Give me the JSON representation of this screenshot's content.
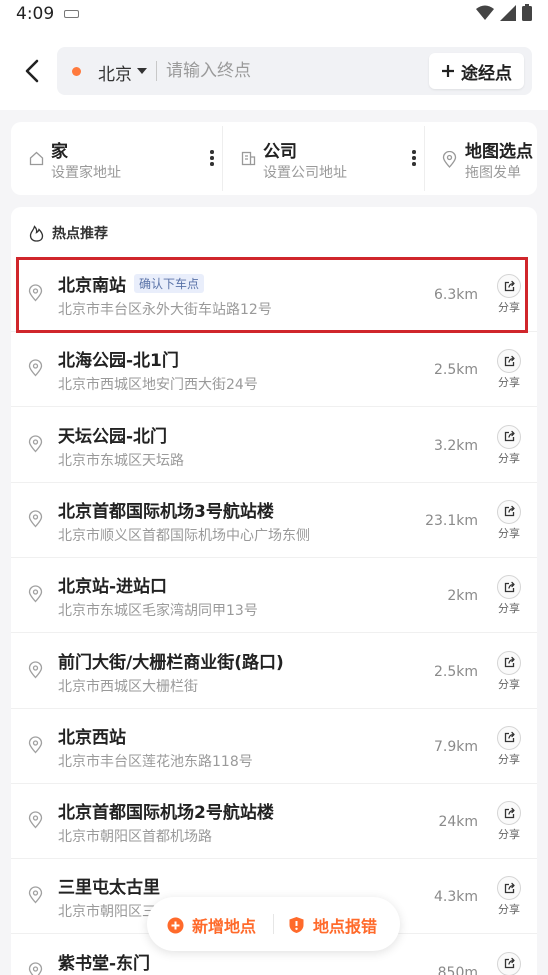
{
  "status_bar": {
    "time": "4:09"
  },
  "header": {
    "city": "北京",
    "destination_placeholder": "请输入终点",
    "waypoint_label": "途经点"
  },
  "quick_access": [
    {
      "title": "家",
      "subtitle": "设置家地址"
    },
    {
      "title": "公司",
      "subtitle": "设置公司地址"
    },
    {
      "title": "地图选点",
      "subtitle": "拖图发单"
    }
  ],
  "hot_spots": {
    "title": "热点推荐",
    "share_label": "分享",
    "items": [
      {
        "name": "北京南站",
        "tag": "确认下车点",
        "address": "北京市丰台区永外大街车站路12号",
        "distance": "6.3km"
      },
      {
        "name": "北海公园-北1门",
        "address": "北京市西城区地安门西大街24号",
        "distance": "2.5km"
      },
      {
        "name": "天坛公园-北门",
        "address": "北京市东城区天坛路",
        "distance": "3.2km"
      },
      {
        "name": "北京首都国际机场3号航站楼",
        "address": "北京市顺义区首都国际机场中心广场东侧",
        "distance": "23.1km"
      },
      {
        "name": "北京站-进站口",
        "address": "北京市东城区毛家湾胡同甲13号",
        "distance": "2km"
      },
      {
        "name": "前门大街/大栅栏商业街(路口)",
        "address": "北京市西城区大栅栏街",
        "distance": "2.5km"
      },
      {
        "name": "北京西站",
        "address": "北京市丰台区莲花池东路118号",
        "distance": "7.9km"
      },
      {
        "name": "北京首都国际机场2号航站楼",
        "address": "北京市朝阳区首都机场路",
        "distance": "24km"
      },
      {
        "name": "三里屯太古里",
        "address": "北京市朝阳区三",
        "distance": "4.3km"
      },
      {
        "name": "紫书堂-东门",
        "address": "",
        "distance": "850m"
      }
    ]
  },
  "float_bar": {
    "add_label": "新增地点",
    "report_label": "地点报错"
  },
  "colors": {
    "accent": "#ff6a2b",
    "highlight_box": "#d0262b"
  }
}
